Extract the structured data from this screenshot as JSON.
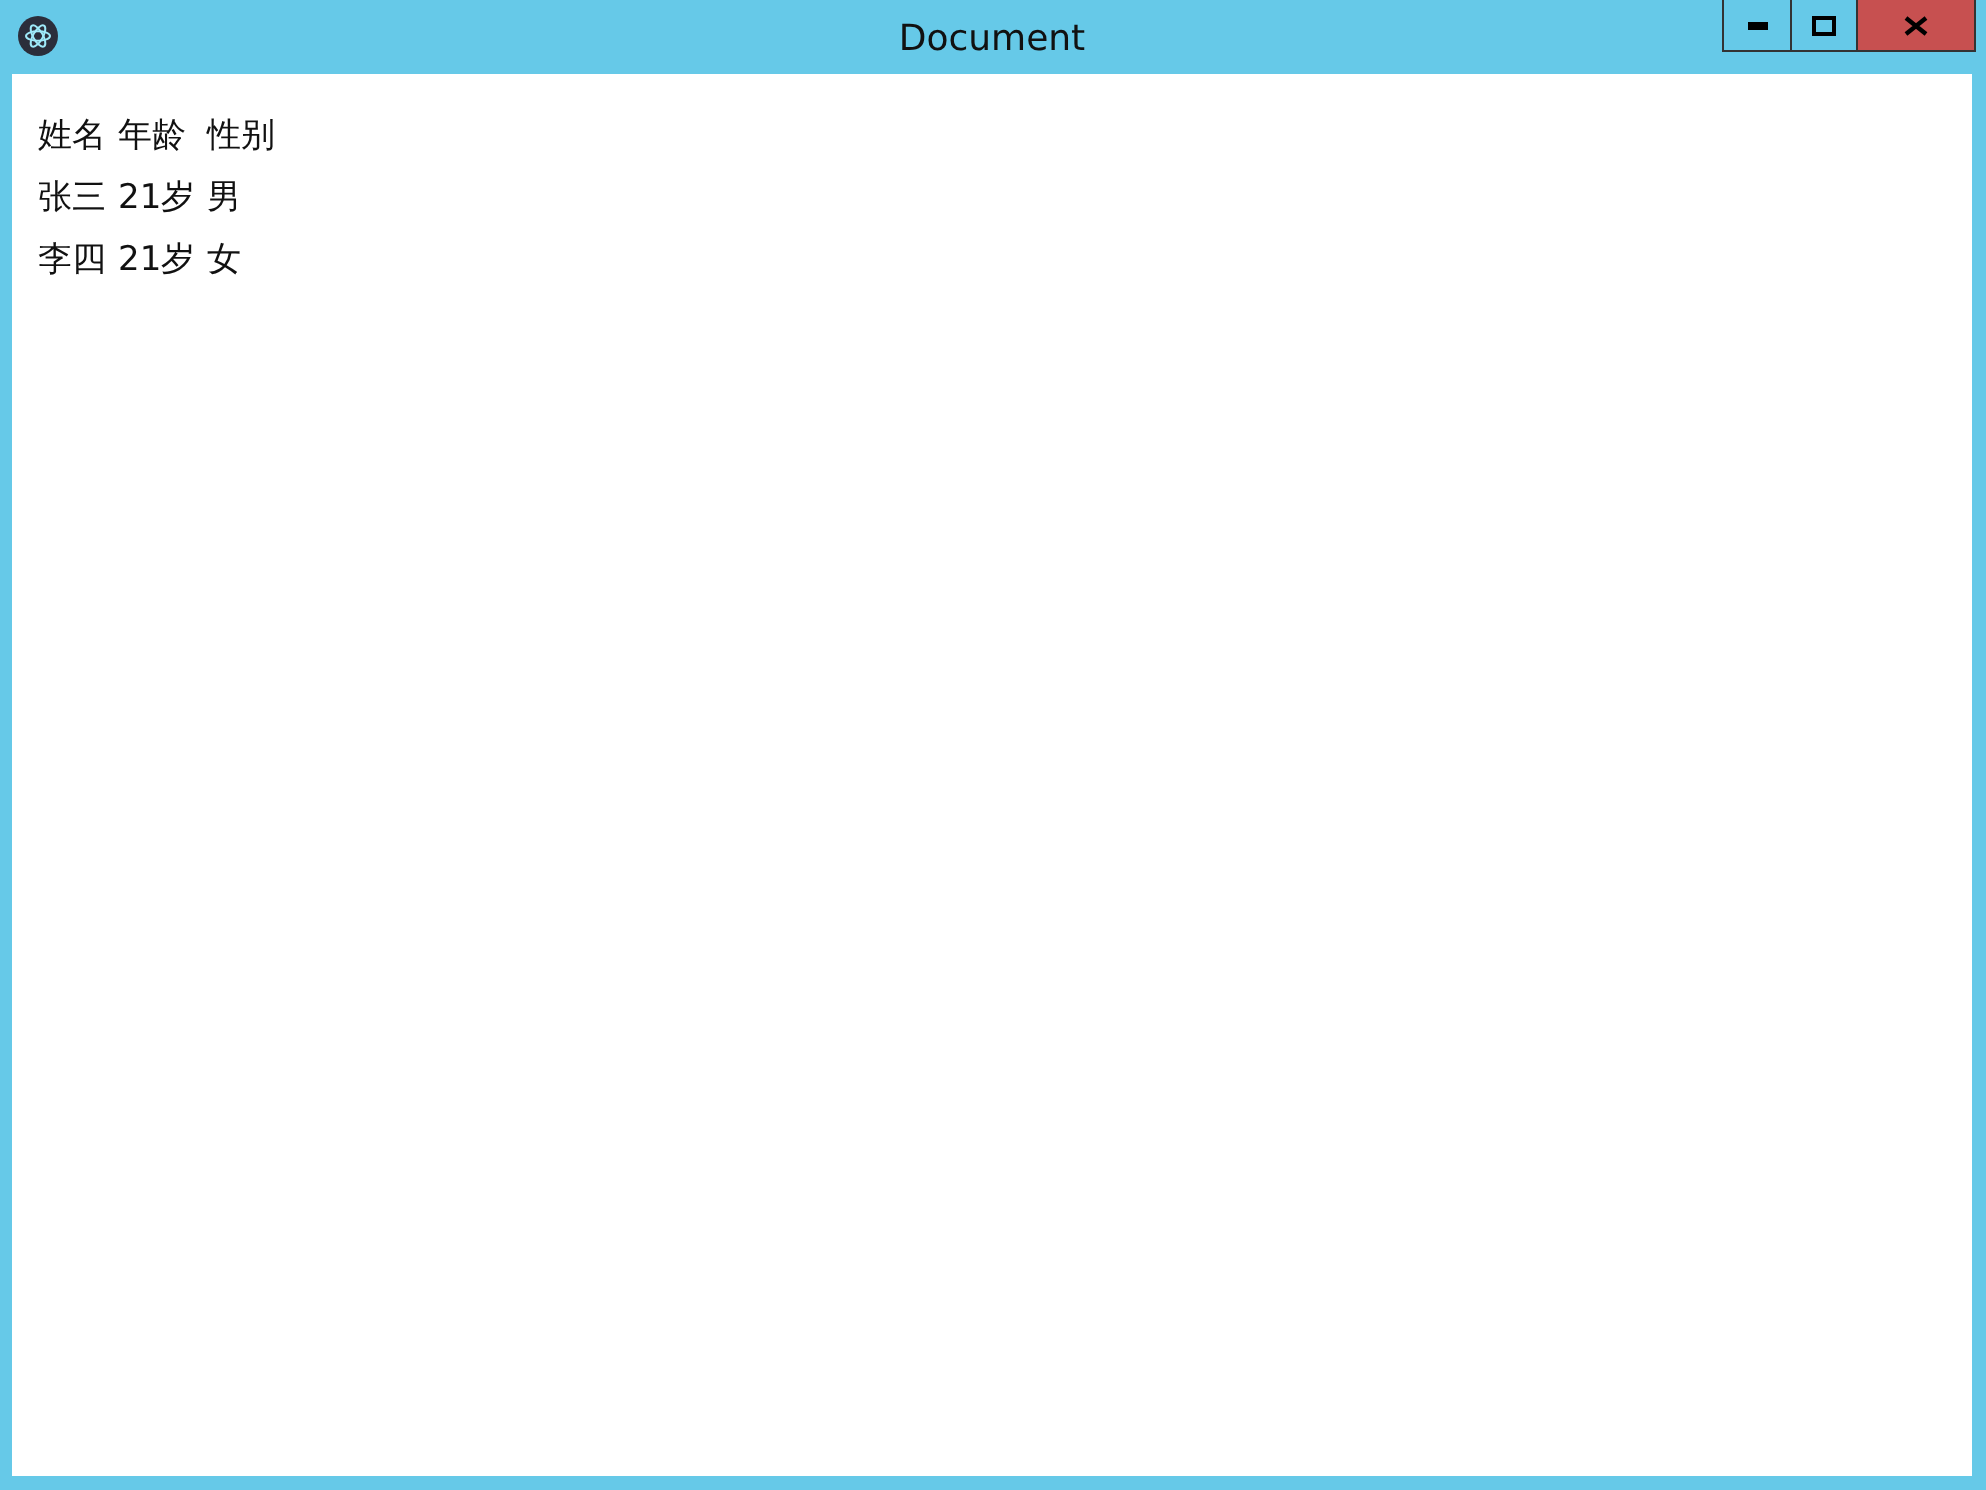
{
  "window": {
    "title": "Document"
  },
  "table": {
    "columns": [
      "姓名",
      "年龄",
      "性别"
    ],
    "rows": [
      [
        "张三",
        "21岁",
        "男"
      ],
      [
        "李四",
        "21岁",
        "女"
      ]
    ]
  }
}
